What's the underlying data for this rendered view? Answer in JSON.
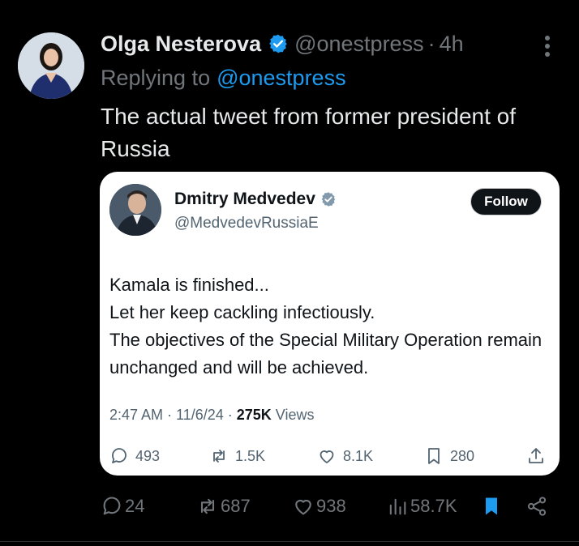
{
  "tweet": {
    "display_name": "Olga Nesterova",
    "handle": "@onestpress",
    "separator": "·",
    "time": "4h",
    "replying_prefix": "Replying to",
    "replying_to": "@onestpress",
    "text": "The actual tweet from former president of Russia",
    "stats": {
      "replies": "24",
      "reposts": "687",
      "likes": "938",
      "views": "58.7K"
    }
  },
  "embedded": {
    "display_name": "Dmitry Medvedev",
    "handle": "@MedvedevRussiaE",
    "follow_label": "Follow",
    "lines": [
      "Kamala is finished...",
      "Let her keep cackling infectiously.",
      "The objectives of the Special Military Operation remain unchanged and will be achieved."
    ],
    "timestamp": "2:47 AM · 11/6/24 · ",
    "views_count": "275K",
    "views_label": " Views",
    "stats": {
      "replies": "493",
      "reposts": "1.5K",
      "likes": "8.1K",
      "bookmarks": "280"
    }
  },
  "colors": {
    "background": "#000000",
    "accent": "#1d9bf0",
    "muted": "#71767b",
    "card_bg": "#ffffff"
  }
}
